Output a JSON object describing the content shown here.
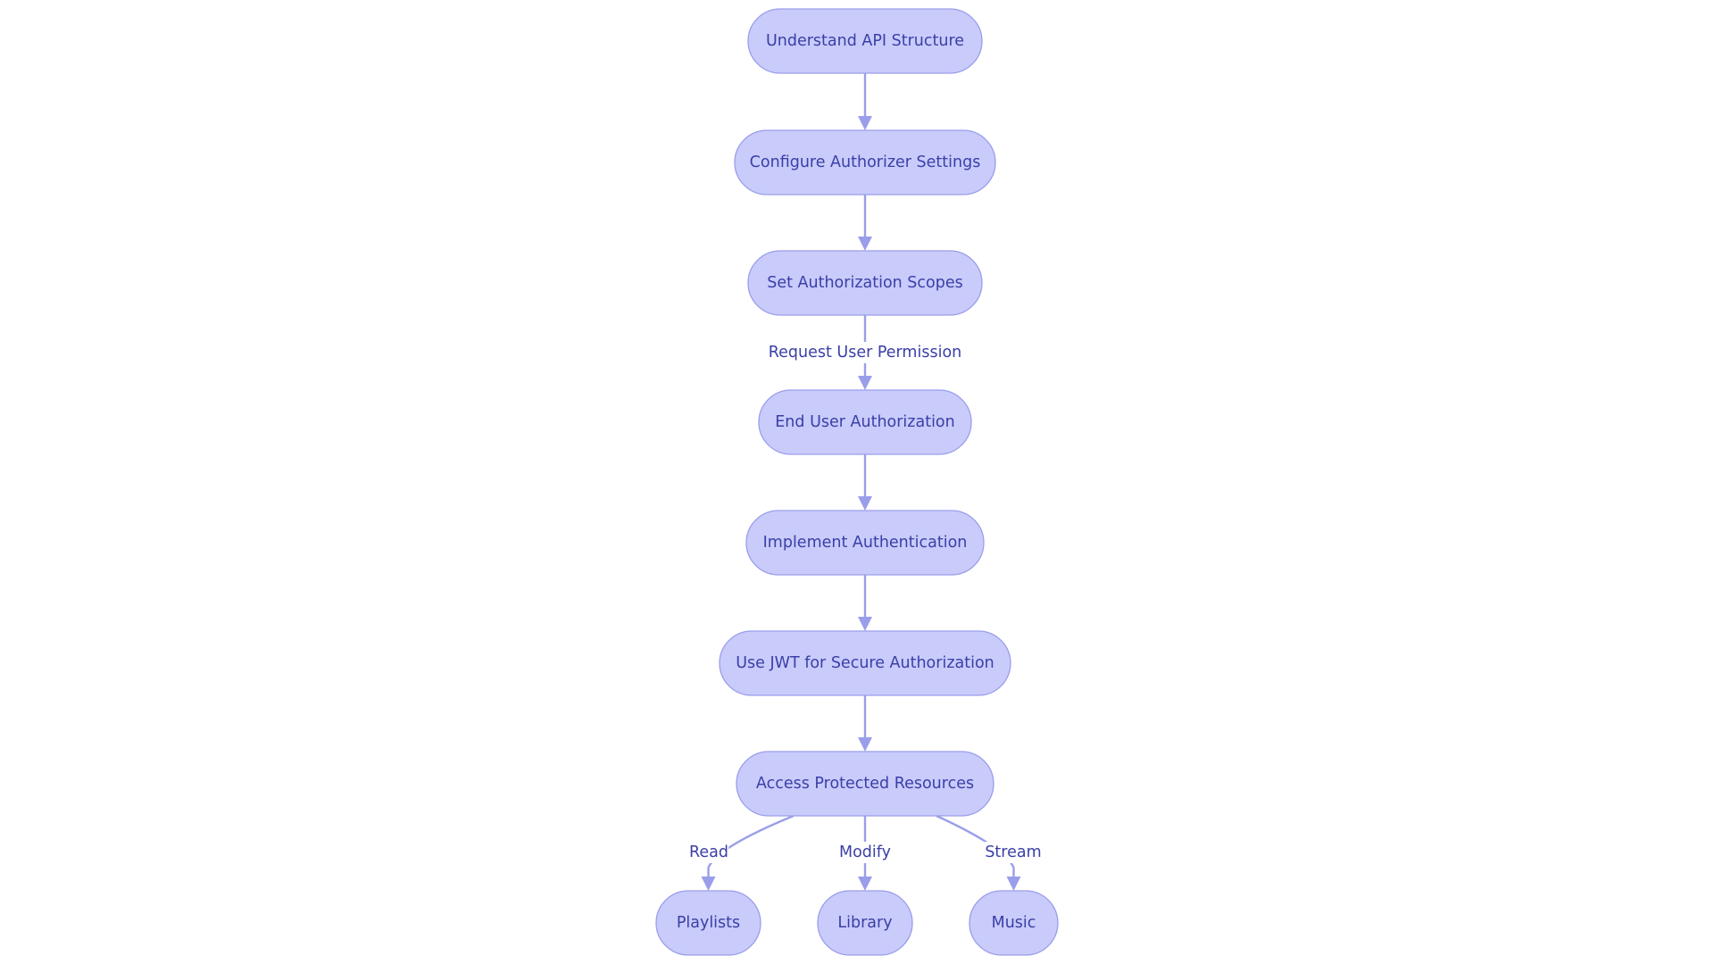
{
  "diagram": {
    "type": "flowchart",
    "colors": {
      "node_fill": "#c9cbfb",
      "node_stroke": "#9a9eea",
      "text": "#3a3fa6",
      "edge": "#9a9eea",
      "background": "#ffffff"
    },
    "nodes": [
      {
        "id": "understand",
        "label": "Understand API Structure"
      },
      {
        "id": "configure",
        "label": "Configure Authorizer Settings"
      },
      {
        "id": "scopes",
        "label": "Set Authorization Scopes"
      },
      {
        "id": "enduser",
        "label": "End User Authorization"
      },
      {
        "id": "authn",
        "label": "Implement Authentication"
      },
      {
        "id": "jwt",
        "label": "Use JWT for Secure Authorization"
      },
      {
        "id": "access",
        "label": "Access Protected Resources"
      },
      {
        "id": "playlists",
        "label": "Playlists"
      },
      {
        "id": "library",
        "label": "Library"
      },
      {
        "id": "music",
        "label": "Music"
      }
    ],
    "edges": [
      {
        "from": "understand",
        "to": "configure",
        "label": ""
      },
      {
        "from": "configure",
        "to": "scopes",
        "label": ""
      },
      {
        "from": "scopes",
        "to": "enduser",
        "label": "Request User Permission"
      },
      {
        "from": "enduser",
        "to": "authn",
        "label": ""
      },
      {
        "from": "authn",
        "to": "jwt",
        "label": ""
      },
      {
        "from": "jwt",
        "to": "access",
        "label": ""
      },
      {
        "from": "access",
        "to": "playlists",
        "label": "Read"
      },
      {
        "from": "access",
        "to": "library",
        "label": "Modify"
      },
      {
        "from": "access",
        "to": "music",
        "label": "Stream"
      }
    ]
  }
}
